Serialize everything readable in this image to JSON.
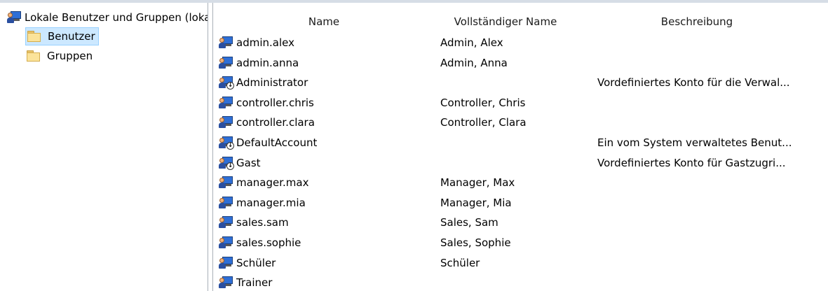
{
  "tree": {
    "root_label": "Lokale Benutzer und Gruppen (lokal)",
    "items": [
      {
        "label": "Benutzer",
        "icon": "folder-icon",
        "selected": true
      },
      {
        "label": "Gruppen",
        "icon": "folder-icon",
        "selected": false
      }
    ]
  },
  "list": {
    "columns": [
      "Name",
      "Vollständiger Name",
      "Beschreibung"
    ],
    "rows": [
      {
        "name": "admin.alex",
        "full_name": "Admin, Alex",
        "description": "",
        "icon": "user-icon"
      },
      {
        "name": "admin.anna",
        "full_name": "Admin, Anna",
        "description": "",
        "icon": "user-icon"
      },
      {
        "name": "Administrator",
        "full_name": "",
        "description": "Vordefiniertes Konto für die Verwal...",
        "icon": "disabled-user-icon"
      },
      {
        "name": "controller.chris",
        "full_name": "Controller, Chris",
        "description": "",
        "icon": "user-icon"
      },
      {
        "name": "controller.clara",
        "full_name": "Controller, Clara",
        "description": "",
        "icon": "user-icon"
      },
      {
        "name": "DefaultAccount",
        "full_name": "",
        "description": "Ein vom System verwaltetes Benut...",
        "icon": "disabled-user-icon"
      },
      {
        "name": "Gast",
        "full_name": "",
        "description": "Vordefiniertes Konto für Gastzugri...",
        "icon": "disabled-user-icon"
      },
      {
        "name": "manager.max",
        "full_name": "Manager, Max",
        "description": "",
        "icon": "user-icon"
      },
      {
        "name": "manager.mia",
        "full_name": "Manager, Mia",
        "description": "",
        "icon": "user-icon"
      },
      {
        "name": "sales.sam",
        "full_name": "Sales, Sam",
        "description": "",
        "icon": "user-icon"
      },
      {
        "name": "sales.sophie",
        "full_name": "Sales, Sophie",
        "description": "",
        "icon": "user-icon"
      },
      {
        "name": "Schüler",
        "full_name": "Schüler",
        "description": "",
        "icon": "user-icon"
      },
      {
        "name": "Trainer",
        "full_name": "",
        "description": "",
        "icon": "user-icon"
      }
    ]
  },
  "colors": {
    "selection_bg": "#cce8ff",
    "selection_border": "#99d1ff",
    "splitter_border": "#a9b0b8"
  }
}
